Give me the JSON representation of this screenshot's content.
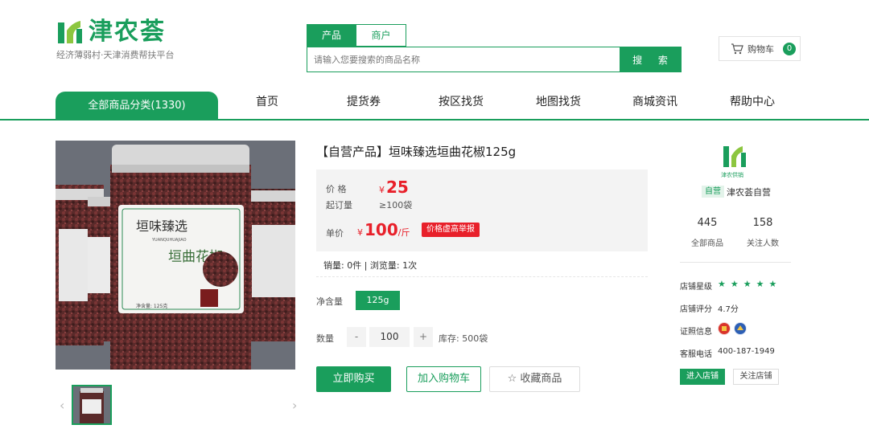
{
  "brand": {
    "name": "津农荟",
    "slogan": "经济薄弱村·天津消费帮扶平台"
  },
  "search": {
    "tabs": [
      "产品",
      "商户"
    ],
    "placeholder": "请输入您要搜索的商品名称",
    "button_label": "搜 索"
  },
  "cart": {
    "label": "购物车",
    "count": "0"
  },
  "nav": {
    "all_categories": "全部商品分类(1330)",
    "items": [
      "首页",
      "提货券",
      "按区找货",
      "地图找货",
      "商城资讯",
      "帮助中心"
    ]
  },
  "product": {
    "title": "【自营产品】垣味臻选垣曲花椒125g",
    "price_label": "价 格",
    "price_yen": "¥",
    "price": "25",
    "moq_label": "起订量",
    "moq_value": "≥100袋",
    "unit_price_label": "单价",
    "unit_price_yen": "¥",
    "unit_price": "100",
    "unit_price_unit": "/斤",
    "report_badge": "价格虚高举报",
    "stats": "销量: 0件   |   浏览量: 1次",
    "spec_label": "净含量",
    "spec_value": "125g",
    "qty_label": "数量",
    "qty_minus": "-",
    "qty_value": "100",
    "qty_plus": "+",
    "stock": "库存: 500袋",
    "buy_label": "立即购买",
    "add_cart_label": "加入购物车",
    "favorite_label": "收藏商品",
    "jar_label_brand": "垣味臻选",
    "jar_label_pinyin": "YUANQUHUAJIAO",
    "jar_label_name": "垣曲花椒",
    "jar_label_weight": "净含量: 125克"
  },
  "shop": {
    "self_badge": "自营",
    "name": "津农荟自营",
    "logo_caption": "津农供销",
    "total_products": "445",
    "total_products_label": "全部商品",
    "followers": "158",
    "followers_label": "关注人数",
    "rating_label": "店铺星级",
    "stars": "★★★★★",
    "score_label": "店铺评分",
    "score_value": "4.7分",
    "license_label": "证照信息",
    "phone_label": "客服电话",
    "phone_value": "400-187-1949",
    "enter_label": "进入店铺",
    "follow_label": "关注店铺"
  },
  "colors": {
    "brand_green": "#1a9e5c",
    "price_red": "#e8202a"
  }
}
